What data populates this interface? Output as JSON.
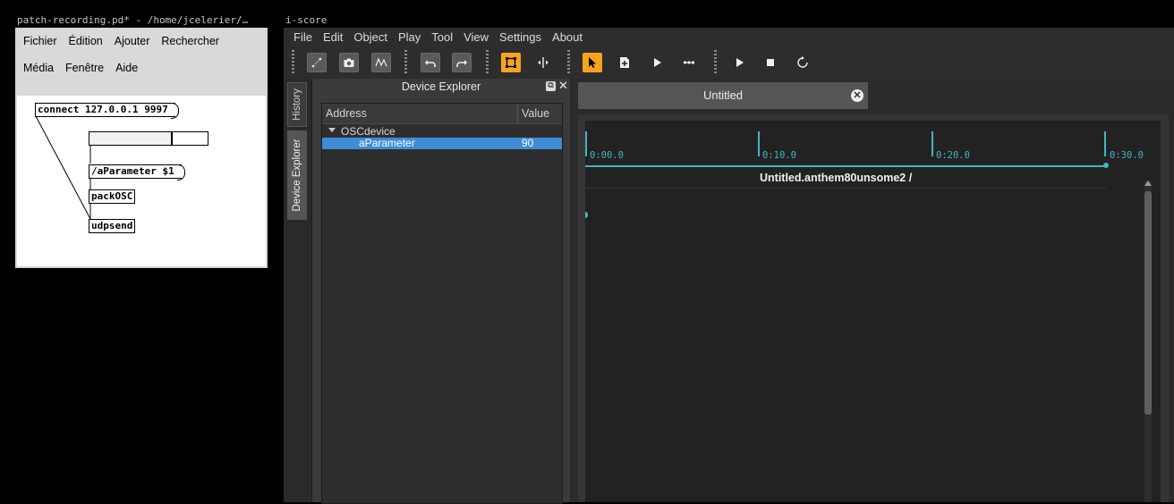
{
  "pd": {
    "title": "patch-recording.pd* - /home/jcelerier/…",
    "menu": [
      "Fichier",
      "Édition",
      "Ajouter",
      "Rechercher",
      "Média",
      "Fenêtre",
      "Aide"
    ],
    "objects": {
      "connect_msg": "connect 127.0.0.1 9997",
      "param_msg": "/aParameter $1",
      "packosc": "packOSC",
      "udpsend": "udpsend"
    },
    "slider_level": 0.69
  },
  "iscore": {
    "title": "i-score",
    "menu": [
      "File",
      "Edit",
      "Object",
      "Play",
      "Tool",
      "View",
      "Settings",
      "About"
    ],
    "dock_tabs": {
      "history": "History",
      "device_explorer": "Device Explorer"
    },
    "device_explorer": {
      "title": "Device Explorer",
      "columns": {
        "address": "Address",
        "value": "Value"
      },
      "rows": [
        {
          "address": "OSCdevice",
          "value": ""
        },
        {
          "address": "aParameter",
          "value": "90"
        }
      ]
    },
    "scenario": {
      "tab_title": "Untitled",
      "ticks": [
        "0:00.0",
        "0:10.0",
        "0:20.0",
        "0:30.0"
      ],
      "label": "Untitled.anthem80unsome2  /"
    }
  },
  "icons": {
    "toolbar": [
      "connect-icon",
      "snapshot-icon",
      "curve-icon",
      "undo-icon",
      "redo-icon",
      "scale-icon",
      "split-icon",
      "select-icon",
      "create-icon",
      "play-icon",
      "sequence-icon",
      "play-all-icon",
      "stop-icon",
      "reinit-icon"
    ]
  },
  "colors": {
    "accent": "#f7a41d",
    "timeline": "#3fb6c4",
    "selection": "#3d8ed6"
  }
}
